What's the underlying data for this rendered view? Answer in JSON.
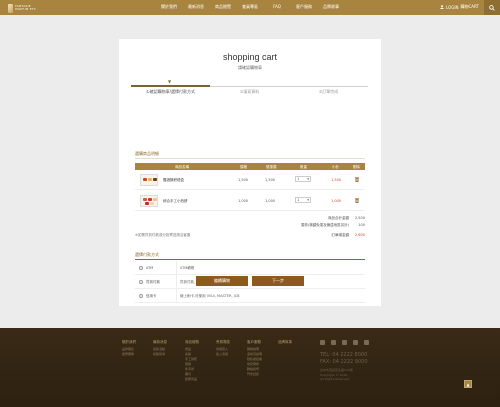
{
  "header": {
    "brand": "FANTASIE",
    "brand_sub": "PARFUM ETC",
    "nav": [
      "關於我們",
      "最新消息",
      "商品總覽",
      "會員專區",
      "FAQ",
      "客戶服務",
      "品牌故事"
    ],
    "login": "LOGIN",
    "cart": "購物CART"
  },
  "page": {
    "title": "shopping cart",
    "subtitle": "請確認購物車",
    "steps": [
      "①確認購物車/選擇付款方式",
      "②填寫資料",
      "③訂單完成"
    ],
    "step_marker": "▼"
  },
  "cart": {
    "section_title": "選購商品明細",
    "columns": [
      "商品名稱",
      "價格",
      "優惠價",
      "數量",
      "小計",
      "刪除"
    ],
    "items": [
      {
        "name": "醒酒酥餅禮盒",
        "price": "1,500",
        "sale": "1,500",
        "qty": "1",
        "subtotal": "1,500"
      },
      {
        "name": "綜合手工小西餅",
        "price": "1,000",
        "sale": "1,000",
        "qty": "1",
        "subtotal": "1,000"
      }
    ],
    "summary": [
      {
        "label": "商品合計金額",
        "value": "2,500"
      },
      {
        "label": "運費(滿額免運及偏遠地區另計)",
        "value": "100"
      }
    ],
    "note": "※如需貨到付款或分批寄送請洽客服",
    "total_label": "訂單總金額",
    "total_value": "2,600"
  },
  "payment": {
    "section_title": "選擇付款方式",
    "options": [
      {
        "name": "ATM",
        "desc": "ATM轉帳"
      },
      {
        "name": "貨到付款",
        "desc": "貨到付款, 限台灣本島宅配"
      },
      {
        "name": "信用卡",
        "desc": "線上刷卡,可使用 VISA, MASTER, JCB"
      }
    ]
  },
  "buttons": {
    "continue": "繼續購物",
    "next": "下一步"
  },
  "footer": {
    "columns": [
      {
        "head": "關於我們",
        "links": [
          "品牌理念",
          "經營團隊"
        ]
      },
      {
        "head": "最新消息",
        "links": [
          "最新活動",
          "媒體報導"
        ]
      },
      {
        "head": "商品總覽",
        "links": [
          "禮盒",
          "喜餅",
          "手工餅乾",
          "蛋糕",
          "伴手禮",
          "彌月",
          "節慶商品"
        ]
      },
      {
        "head": "會員專區",
        "links": [
          "會員登入",
          "加入會員"
        ]
      },
      {
        "head": "客戶服務",
        "links": [
          "購物說明",
          "退換貨說明",
          "隱私權政策",
          "常見問題",
          "聯絡我們",
          "門市資訊"
        ]
      },
      {
        "head": "品牌故事",
        "links": []
      }
    ],
    "tel": "TEL: 04 2222 8000",
    "fax": "FAX: 04 2222 9000",
    "address": [
      "台中市西區民生路100號",
      "Copyright © 2016",
      "All Rights Reserved."
    ],
    "totop": "▲"
  }
}
